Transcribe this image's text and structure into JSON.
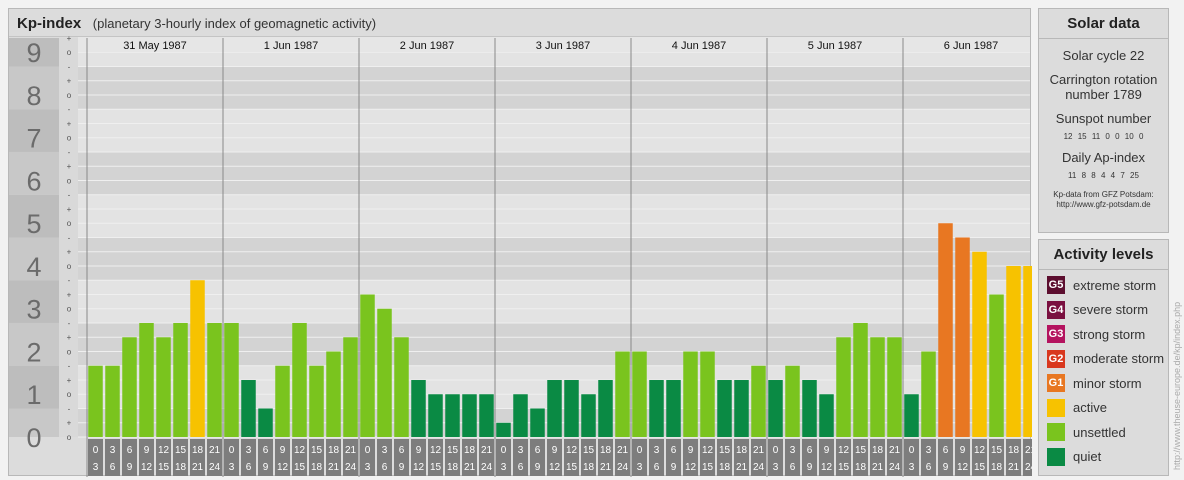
{
  "header": {
    "title": "Kp-index",
    "subtitle": "(planetary 3-hourly index of geomagnetic activity)"
  },
  "solar": {
    "heading": "Solar data",
    "cycle": "Solar cycle 22",
    "carrington": "Carrington rotation number 1789",
    "sunspot_label": "Sunspot number",
    "sunspot_values": [
      "12",
      "15",
      "11",
      "0",
      "0",
      "10",
      "0"
    ],
    "ap_label": "Daily Ap-index",
    "ap_values": [
      "11",
      "8",
      "8",
      "4",
      "4",
      "7",
      "25"
    ],
    "source_line1": "Kp-data from GFZ Potsdam:",
    "source_line2": "http://www.gfz-potsdam.de"
  },
  "activity": {
    "heading": "Activity levels",
    "levels": [
      {
        "code": "G5",
        "label": "extreme storm",
        "color": "#5c0e2f"
      },
      {
        "code": "G4",
        "label": "severe storm",
        "color": "#7a1040"
      },
      {
        "code": "G3",
        "label": "strong storm",
        "color": "#b4135f"
      },
      {
        "code": "G2",
        "label": "moderate storm",
        "color": "#d9381e"
      },
      {
        "code": "G1",
        "label": "minor storm",
        "color": "#e87722"
      },
      {
        "code": "",
        "label": "active",
        "color": "#f7c200"
      },
      {
        "code": "",
        "label": "unsettled",
        "color": "#7ac41e"
      },
      {
        "code": "",
        "label": "quiet",
        "color": "#0a8a44"
      }
    ]
  },
  "watermark": "http://www.theuse-europe.de/kp/index.php",
  "chart_data": {
    "type": "bar",
    "title": "Kp-index",
    "y_ticks": [
      "0",
      "1",
      "2",
      "3",
      "4",
      "5",
      "6",
      "7",
      "8",
      "9"
    ],
    "subticks": [
      "o",
      "+",
      "-"
    ],
    "ylim": [
      0,
      9.333
    ],
    "days": [
      "31 May 1987",
      "1 Jun 1987",
      "2 Jun 1987",
      "3 Jun 1987",
      "4 Jun 1987",
      "5 Jun 1987",
      "6 Jun 1987"
    ],
    "interval_start": [
      "0",
      "3",
      "6",
      "9",
      "12",
      "15",
      "18",
      "21"
    ],
    "interval_end": [
      "3",
      "6",
      "9",
      "12",
      "15",
      "18",
      "21",
      "24"
    ],
    "series": [
      {
        "values": [
          1.667,
          1.667,
          2.333,
          2.667,
          2.333,
          2.667,
          3.667,
          2.667,
          2.667,
          1.333,
          0.667,
          1.667,
          2.667,
          1.667,
          2.0,
          2.333,
          3.333,
          3.0,
          2.333,
          1.333,
          1.0,
          1.0,
          1.0,
          1.0,
          0.333,
          1.0,
          0.667,
          1.333,
          1.333,
          1.0,
          1.333,
          2.0,
          2.0,
          1.333,
          1.333,
          2.0,
          2.0,
          1.333,
          1.333,
          1.667,
          1.333,
          1.667,
          1.333,
          1.0,
          2.333,
          2.667,
          2.333,
          2.333,
          1.0,
          2.0,
          5.0,
          4.667,
          4.333,
          3.333,
          4.0,
          4.0
        ],
        "colors": [
          "#7ac41e",
          "#7ac41e",
          "#7ac41e",
          "#7ac41e",
          "#7ac41e",
          "#7ac41e",
          "#f7c200",
          "#7ac41e",
          "#7ac41e",
          "#0a8a44",
          "#0a8a44",
          "#7ac41e",
          "#7ac41e",
          "#7ac41e",
          "#7ac41e",
          "#7ac41e",
          "#7ac41e",
          "#7ac41e",
          "#7ac41e",
          "#0a8a44",
          "#0a8a44",
          "#0a8a44",
          "#0a8a44",
          "#0a8a44",
          "#0a8a44",
          "#0a8a44",
          "#0a8a44",
          "#0a8a44",
          "#0a8a44",
          "#0a8a44",
          "#0a8a44",
          "#7ac41e",
          "#7ac41e",
          "#0a8a44",
          "#0a8a44",
          "#7ac41e",
          "#7ac41e",
          "#0a8a44",
          "#0a8a44",
          "#7ac41e",
          "#0a8a44",
          "#7ac41e",
          "#0a8a44",
          "#0a8a44",
          "#7ac41e",
          "#7ac41e",
          "#7ac41e",
          "#7ac41e",
          "#0a8a44",
          "#7ac41e",
          "#e87722",
          "#e87722",
          "#f7c200",
          "#7ac41e",
          "#f7c200",
          "#f7c200"
        ]
      }
    ]
  }
}
